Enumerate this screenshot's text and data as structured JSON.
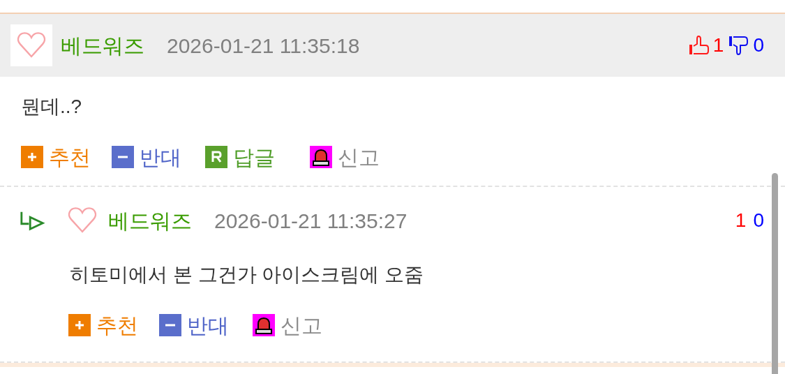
{
  "comments": [
    {
      "kind": "comment",
      "author": "베드워즈",
      "date": "2026-01-21 11:35:18",
      "up": "1",
      "down": "0",
      "body": "뭔데..?",
      "actions": [
        {
          "kind": "recommend",
          "label": "추천"
        },
        {
          "kind": "oppose",
          "label": "반대"
        },
        {
          "kind": "reply",
          "label": "답글"
        },
        {
          "kind": "report",
          "label": "신고"
        }
      ]
    },
    {
      "kind": "reply",
      "author": "베드워즈",
      "date": "2026-01-21 11:35:27",
      "up": "1",
      "down": "0",
      "body": "히토미에서 본 그건가 아이스크림에 오줌",
      "actions": [
        {
          "kind": "recommend",
          "label": "추천"
        },
        {
          "kind": "oppose",
          "label": "반대"
        },
        {
          "kind": "report",
          "label": "신고"
        }
      ]
    }
  ]
}
